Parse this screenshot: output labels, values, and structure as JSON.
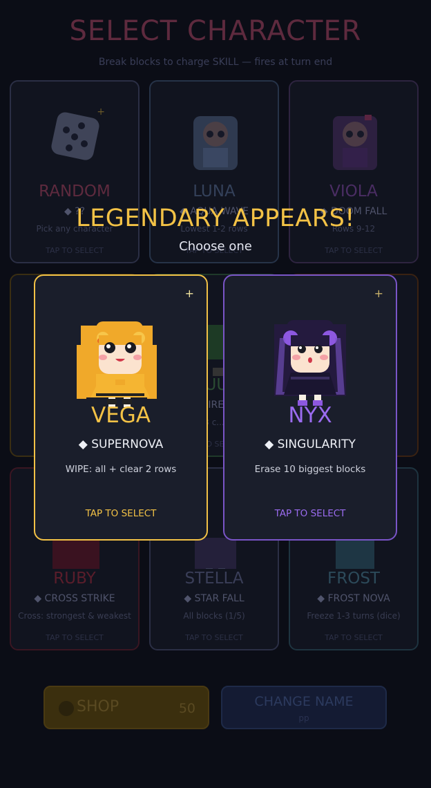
{
  "screen": {
    "title": "SELECT CHARACTER",
    "subtitle": "Break blocks to charge SKILL — fires at turn end"
  },
  "characters": [
    {
      "name": "RANDOM",
      "skill": "◆ ??",
      "desc": "Pick any character",
      "tap": "TAP TO SELECT",
      "color": "#5e2a3e"
    },
    {
      "name": "LUNA",
      "skill": "◆ AQUA WAVE",
      "desc": "Lowest 1-2 rows",
      "tap": "TAP TO SELECT",
      "color": "#34415a"
    },
    {
      "name": "VIOLA",
      "skill": "◆ DOOM FALL",
      "desc": "Rows 9-12",
      "tap": "TAP TO SELECT",
      "color": "#4a2d63"
    },
    {
      "name": "",
      "skill": "",
      "desc": "",
      "tap": "",
      "color": "#4a3615"
    },
    {
      "name": "JUU",
      "skill": "◆ FIRE ...",
      "desc": "3 c...",
      "tap": "TAP TO SELECT",
      "color": "#2a4a32"
    },
    {
      "name": "",
      "skill": "",
      "desc": "",
      "tap": "",
      "color": "#4a2415"
    },
    {
      "name": "RUBY",
      "skill": "◆ CROSS STRIKE",
      "desc": "Cross: strongest & weakest",
      "tap": "TAP TO SELECT",
      "color": "#5a1d2b"
    },
    {
      "name": "STELLA",
      "skill": "◆ STAR FALL",
      "desc": "All blocks (1/5)",
      "tap": "TAP TO SELECT",
      "color": "#3a3e58"
    },
    {
      "name": "FROST",
      "skill": "◆ FROST NOVA",
      "desc": "Freeze 1-3 turns (dice)",
      "tap": "TAP TO SELECT",
      "color": "#2c4a5a"
    }
  ],
  "shop": {
    "label": "SHOP",
    "coins": "50"
  },
  "change_name": {
    "label": "CHANGE NAME",
    "current": "pp"
  },
  "legendary": {
    "title": "LEGENDARY APPEARS!",
    "subtitle": "Choose one",
    "options": [
      {
        "name": "VEGA",
        "skill": "◆ SUPERNOVA",
        "desc": "WIPE: all + clear 2 rows",
        "tap": "TAP TO SELECT",
        "color": "#f3c246"
      },
      {
        "name": "NYX",
        "skill": "◆ SINGULARITY",
        "desc": "Erase 10 biggest blocks",
        "tap": "TAP TO SELECT",
        "color": "#9b6cf0"
      }
    ]
  }
}
